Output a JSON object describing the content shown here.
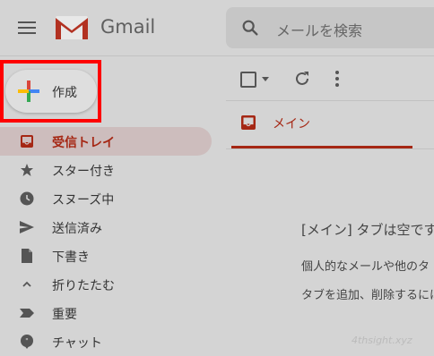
{
  "header": {
    "logo_text": "Gmail",
    "search_placeholder": "メールを検索"
  },
  "compose": {
    "label": "作成"
  },
  "sidebar": {
    "items": [
      {
        "label": "受信トレイ",
        "icon": "inbox-icon",
        "active": true
      },
      {
        "label": "スター付き",
        "icon": "star-icon"
      },
      {
        "label": "スヌーズ中",
        "icon": "clock-icon"
      },
      {
        "label": "送信済み",
        "icon": "send-icon"
      },
      {
        "label": "下書き",
        "icon": "draft-icon"
      },
      {
        "label": "折りたたむ",
        "icon": "chevron-up-icon"
      },
      {
        "label": "重要",
        "icon": "important-icon"
      },
      {
        "label": "チャット",
        "icon": "chat-icon"
      }
    ]
  },
  "tabs": {
    "main_label": "メイン"
  },
  "empty_state": {
    "title": "[メイン] タブは空です",
    "line1": "個人的なメールや他のタ",
    "line2": "タブを追加、削除するには"
  },
  "watermark": "4thsight.xyz",
  "colors": {
    "accent_red": "#a52714",
    "highlight_red": "#ff0000",
    "background_gray": "#d4d4d4"
  }
}
